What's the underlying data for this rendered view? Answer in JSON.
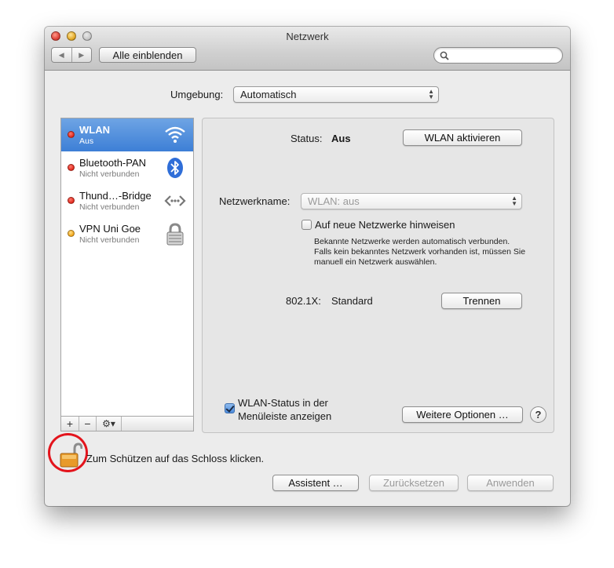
{
  "window": {
    "title": "Netzwerk"
  },
  "toolbar": {
    "back_icon": "◀",
    "forward_icon": "▶",
    "show_all_label": "Alle einblenden",
    "search_placeholder": ""
  },
  "location": {
    "label": "Umgebung:",
    "value": "Automatisch"
  },
  "services": [
    {
      "name": "WLAN",
      "state": "Aus",
      "status_color": "#e0261a",
      "icon": "wifi-icon",
      "selected": true
    },
    {
      "name": "Bluetooth-PAN",
      "state": "Nicht verbunden",
      "status_color": "#e0261a",
      "icon": "bluetooth-icon",
      "selected": false
    },
    {
      "name": "Thund…-Bridge",
      "state": "Nicht verbunden",
      "status_color": "#e0261a",
      "icon": "thunderbolt-bridge-icon",
      "selected": false
    },
    {
      "name": "VPN Uni Goe",
      "state": "Nicht verbunden",
      "status_color": "#f1a316",
      "icon": "vpn-lock-icon",
      "selected": false
    }
  ],
  "sidebar_toolbar": {
    "add": "+",
    "remove": "−",
    "gear": "⚙▾"
  },
  "detail": {
    "status_label": "Status:",
    "status_value": "Aus",
    "enable_wifi_button": "WLAN aktivieren",
    "network_name_label": "Netzwerkname:",
    "network_name_value": "WLAN: aus",
    "ask_join_label": "Auf neue Netzwerke hinweisen",
    "ask_join_checked": false,
    "ask_join_help": [
      "Bekannte Netzwerke werden automatisch verbunden.",
      "Falls kein bekanntes Netzwerk vorhanden ist, müssen Sie",
      "manuell ein Netzwerk auswählen."
    ],
    "dot1x_label": "802.1X:",
    "dot1x_value": "Standard",
    "disconnect_button": "Trennen",
    "show_status_label_line1": "WLAN-Status in der",
    "show_status_label_line2": "Menüleiste anzeigen",
    "show_status_checked": true,
    "advanced_button": "Weitere Optionen …",
    "help_button": "?"
  },
  "lock": {
    "text": "Zum Schützen auf das Schloss klicken.",
    "highlight_color": "#e3141c"
  },
  "bottom_buttons": {
    "assistant": "Assistent …",
    "revert": "Zurücksetzen",
    "apply": "Anwenden"
  }
}
